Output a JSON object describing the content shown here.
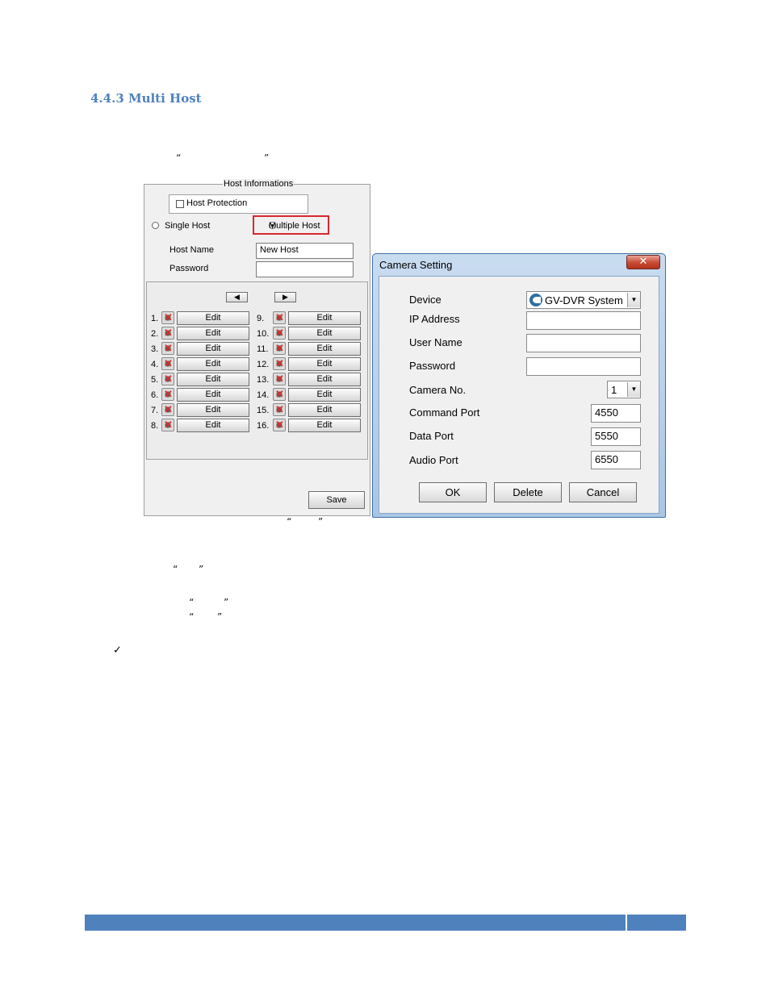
{
  "section_heading": "4.4.3 Multi Host",
  "quotes": {
    "q1_open": "“",
    "q1_close": "”",
    "q2_open": "“",
    "q2_close": "”",
    "q3_open": "“",
    "q3_close": "”",
    "q4_open": "“",
    "q4_close": "”",
    "q5_open": "“",
    "q5_close": "”"
  },
  "checkmark": "✓",
  "host_panel": {
    "title": "Host Informations",
    "protection_label": "Host Protection",
    "single_host_label": "Single Host",
    "multiple_host_label": "Multiple Host",
    "host_name_label": "Host Name",
    "host_name_value": "New Host",
    "password_label": "Password",
    "password_value": "",
    "prev_arrow": "◀",
    "next_arrow": "▶",
    "edit_label": "Edit",
    "cameras": [
      {
        "num": "1."
      },
      {
        "num": "2."
      },
      {
        "num": "3."
      },
      {
        "num": "4."
      },
      {
        "num": "5."
      },
      {
        "num": "6."
      },
      {
        "num": "7."
      },
      {
        "num": "8."
      },
      {
        "num": "9."
      },
      {
        "num": "10."
      },
      {
        "num": "11."
      },
      {
        "num": "12."
      },
      {
        "num": "13."
      },
      {
        "num": "14."
      },
      {
        "num": "15."
      },
      {
        "num": "16."
      }
    ],
    "save_label": "Save"
  },
  "camera_dialog": {
    "title": "Camera Setting",
    "close_glyph": "✕",
    "device_label": "Device",
    "device_value": "GV-DVR System",
    "ip_label": "IP Address",
    "ip_value": "",
    "user_label": "User Name",
    "user_value": "",
    "password_label": "Password",
    "password_value": "",
    "camera_no_label": "Camera No.",
    "camera_no_value": "1",
    "command_port_label": "Command Port",
    "command_port_value": "4550",
    "data_port_label": "Data Port",
    "data_port_value": "5550",
    "audio_port_label": "Audio Port",
    "audio_port_value": "6550",
    "ok_label": "OK",
    "delete_label": "Delete",
    "cancel_label": "Cancel"
  },
  "colors": {
    "heading": "#4F81BD",
    "footer_bar": "#4F81BD",
    "highlight_box": "#d8272e"
  }
}
